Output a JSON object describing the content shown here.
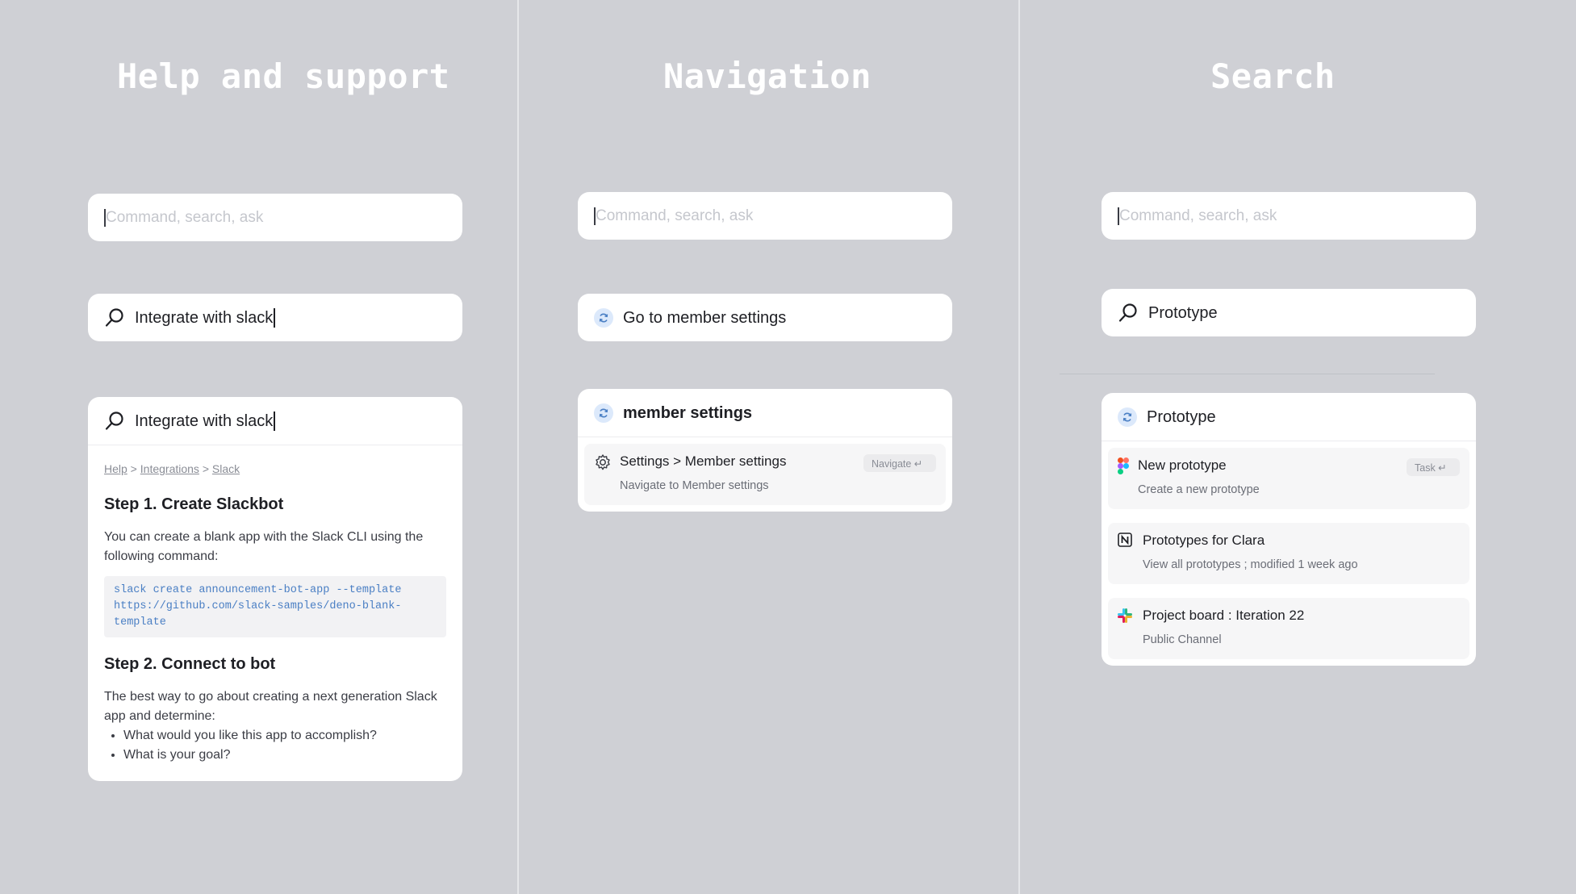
{
  "columns": {
    "help": {
      "title": "Help and support",
      "empty_input": {
        "placeholder": "Command, search, ask",
        "icon": "text-caret"
      },
      "typed_input": {
        "value": "Integrate with slack",
        "icon": "search-icon"
      },
      "article": {
        "query": "Integrate with slack",
        "breadcrumb": [
          "Help",
          "Integrations",
          "Slack"
        ],
        "step1_title": "Step 1. Create Slackbot",
        "step1_text": "You can create a blank app with the Slack CLI using the following command:",
        "code_lines": [
          "slack create announcement-bot-app --template",
          "https://github.com/slack-samples/deno-blank-",
          "template"
        ],
        "step2_title": "Step 2. Connect to bot",
        "step2_text": "The best way to go about creating a next generation Slack app and determine:",
        "bullets": [
          "What would you like this app to accomplish?",
          "What is your goal?"
        ]
      }
    },
    "navigation": {
      "title": "Navigation",
      "empty_input": {
        "placeholder": "Command, search, ask"
      },
      "suggestion": {
        "value": "Go to member settings",
        "icon": "refresh-circle-icon"
      },
      "panel": {
        "query": "member settings",
        "result": {
          "icon": "gear-icon",
          "title": "Settings > Member settings",
          "subtitle": "Navigate to Member settings",
          "action": "Navigate ↵"
        }
      }
    },
    "search": {
      "title": "Search",
      "empty_input": {
        "placeholder": "Command, search, ask"
      },
      "typed_input": {
        "value": "Prototype",
        "icon": "search-icon"
      },
      "panel": {
        "query": "Prototype",
        "results": [
          {
            "icon": "figma-icon",
            "title": "New prototype",
            "subtitle": "Create a new prototype",
            "action": "Task ↵"
          },
          {
            "icon": "notion-icon",
            "title": "Prototypes for Clara",
            "subtitle": "View all prototypes ;  modified 1 week ago"
          },
          {
            "icon": "slack-icon",
            "title": "Project board : Iteration 22",
            "subtitle": "Public Channel"
          }
        ]
      }
    }
  },
  "colors": {
    "background": "#cfd0d5",
    "card": "#ffffff",
    "title_text": "#ffffff",
    "accent_blue": "#4a7fc4",
    "result_bg": "#f6f6f7"
  }
}
